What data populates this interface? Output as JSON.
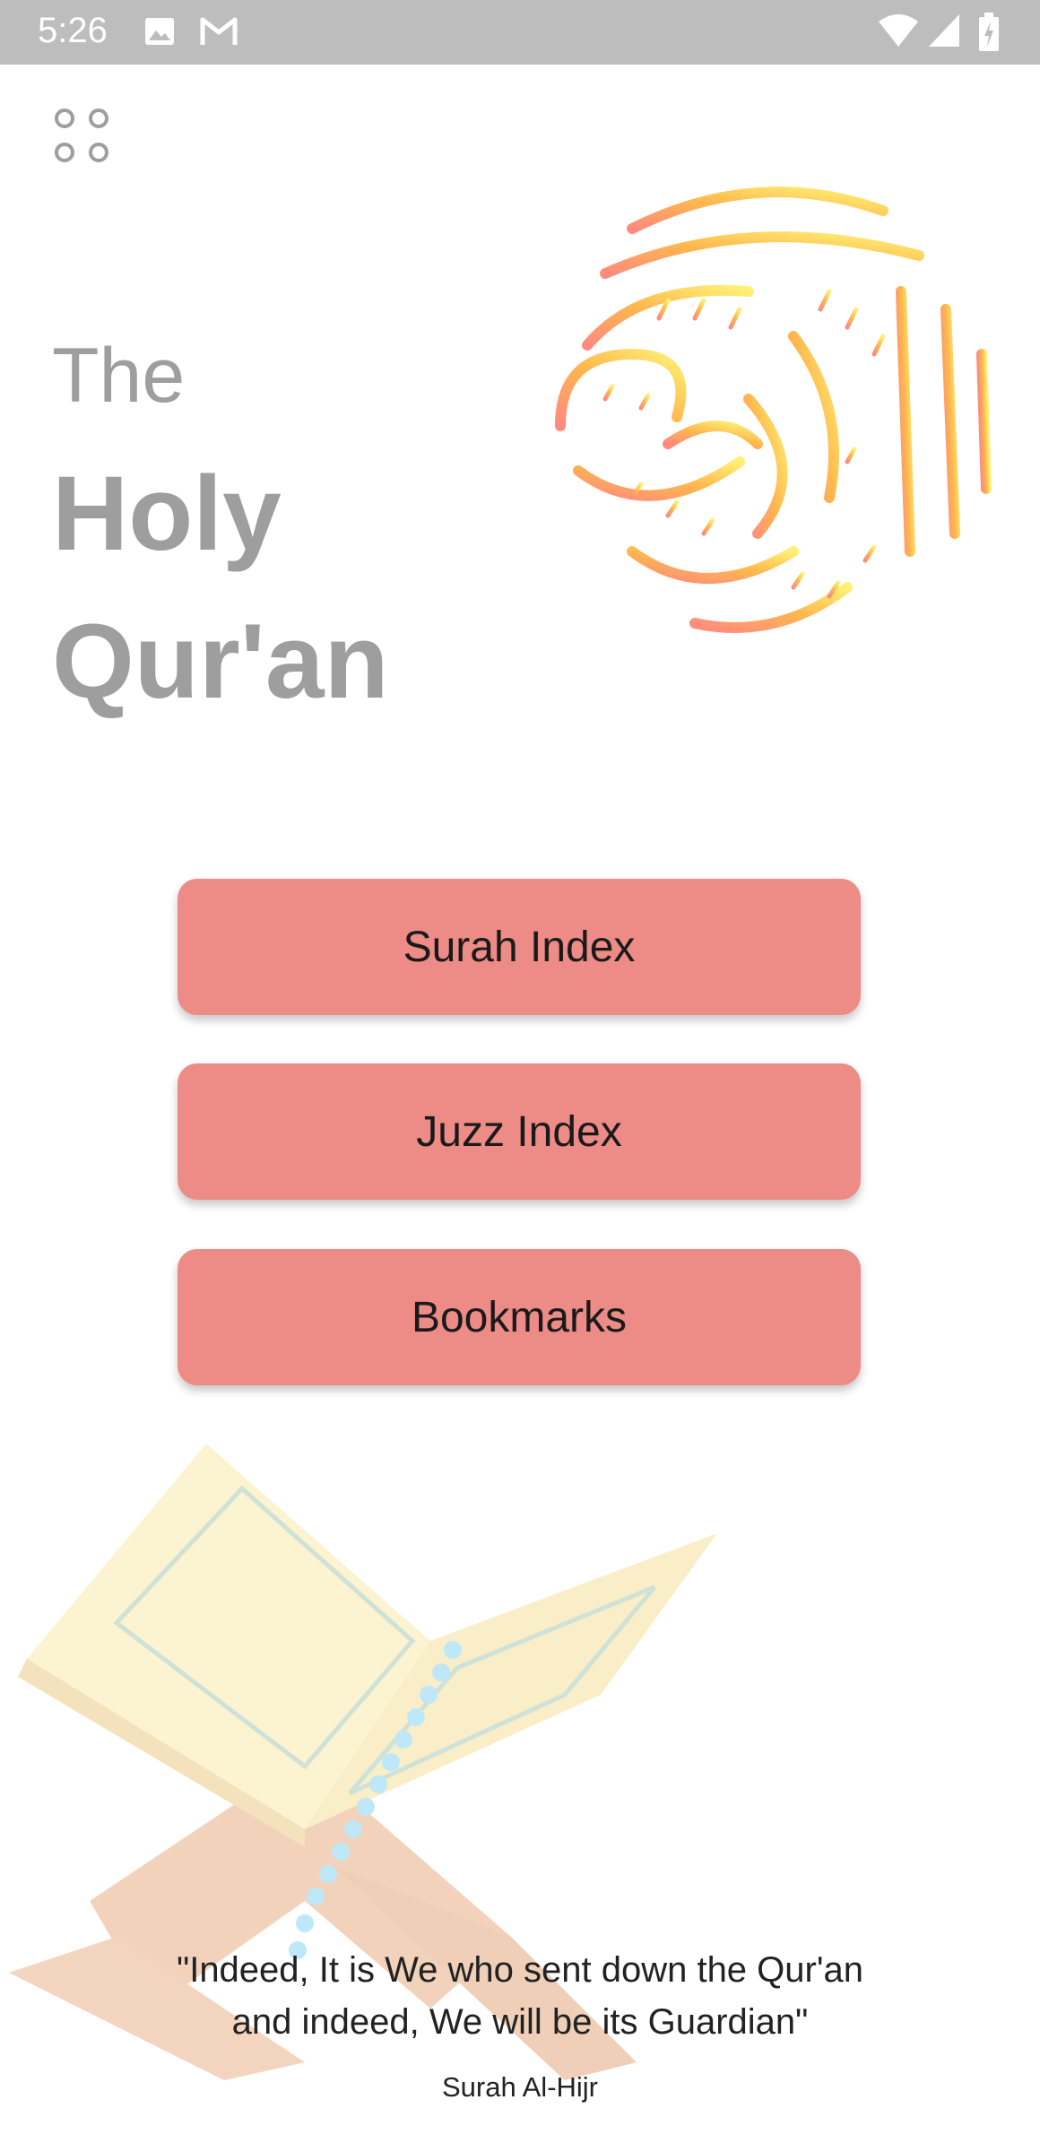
{
  "status_bar": {
    "time": "5:26",
    "icons": [
      "image-icon",
      "gmail-icon",
      "wifi-icon",
      "signal-icon",
      "battery-icon"
    ]
  },
  "menu": {
    "icon": "grid-dots-icon"
  },
  "title": {
    "line1": "The",
    "line2": "Holy",
    "line3": "Qur'an"
  },
  "buttons": {
    "surah": "Surah Index",
    "juzz": "Juzz Index",
    "bookmarks": "Bookmarks"
  },
  "quote": {
    "line1": "\"Indeed, It is We who sent down the Qur'an",
    "line2": "and indeed, We will be its Guardian\"",
    "source": "Surah Al-Hijr"
  },
  "colors": {
    "button": "#ed8b86",
    "title": "#9e9e9e",
    "statusbar": "#bdbdbd"
  }
}
